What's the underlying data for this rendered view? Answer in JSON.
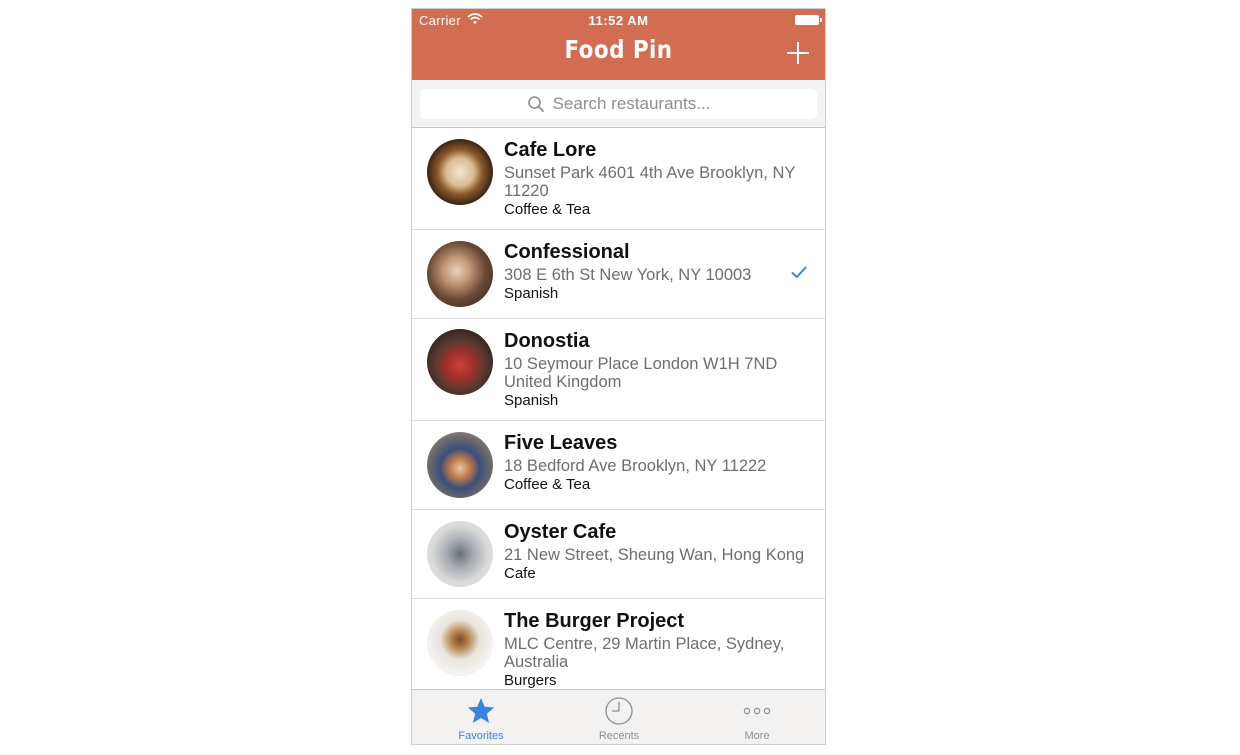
{
  "status_bar": {
    "carrier": "Carrier",
    "time": "11:52 AM"
  },
  "navbar": {
    "title": "Food Pin",
    "add_icon": "plus-icon"
  },
  "search": {
    "placeholder": "Search restaurants...",
    "icon": "search-icon"
  },
  "restaurants": [
    {
      "name": "Cafe Lore",
      "address": "Sunset Park 4601 4th Ave Brooklyn, NY 11220",
      "type": "Coffee & Tea",
      "checked": false
    },
    {
      "name": "Confessional",
      "address": "308 E 6th St New York, NY 10003",
      "type": "Spanish",
      "checked": true
    },
    {
      "name": "Donostia",
      "address": "10 Seymour Place London W1H 7ND United Kingdom",
      "type": "Spanish",
      "checked": false
    },
    {
      "name": "Five Leaves",
      "address": "18 Bedford Ave Brooklyn, NY 11222",
      "type": "Coffee & Tea",
      "checked": false
    },
    {
      "name": "Oyster Cafe",
      "address": "21 New Street, Sheung Wan, Hong Kong",
      "type": "Cafe",
      "checked": false
    },
    {
      "name": "The Burger Project",
      "address": "MLC Centre, 29 Martin Place, Sydney, Australia",
      "type": "Burgers",
      "checked": false
    }
  ],
  "tabbar": {
    "favorites": "Favorites",
    "recents": "Recents",
    "more": "More",
    "active": "Favorites"
  },
  "colors": {
    "nav": "#d26d52",
    "accent": "#3c82df",
    "secondary_text": "#6d6d72"
  }
}
